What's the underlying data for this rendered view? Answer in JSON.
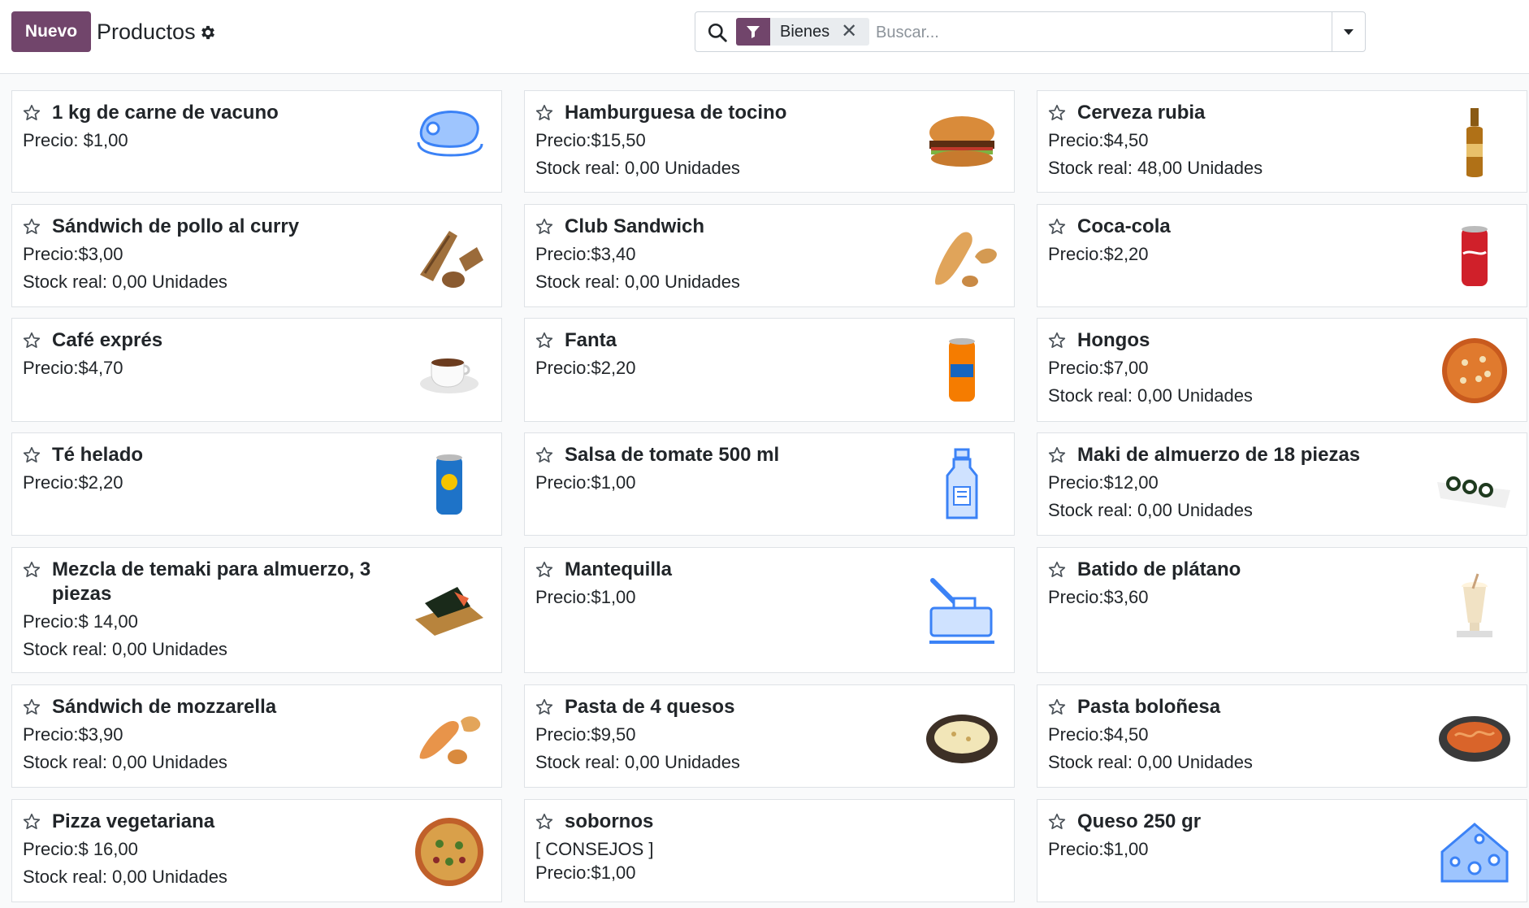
{
  "header": {
    "new_button": "Nuevo",
    "title": "Productos",
    "settings_icon": "gear-icon",
    "search": {
      "icon": "search-icon",
      "facet_icon": "filter-icon",
      "facet_label": "Bienes",
      "facet_remove": "✕",
      "placeholder": "Buscar...",
      "toggle_icon": "caret-down-icon"
    }
  },
  "colors": {
    "brand": "#71456b",
    "text": "#212529",
    "border": "#dee2e6"
  },
  "products": [
    {
      "name": "1 kg de carne de vacuno",
      "lines": [
        "Precio: $1,00"
      ],
      "image": "steak-icon"
    },
    {
      "name": "Hamburguesa de tocino",
      "lines": [
        "Precio:$15,50",
        "Stock real: 0,00 Unidades"
      ],
      "image": "burger-image"
    },
    {
      "name": "Cerveza rubia",
      "lines": [
        "Precio:$4,50",
        "Stock real: 48,00 Unidades"
      ],
      "image": "beer-bottle-image"
    },
    {
      "name": "Sándwich de pollo al curry",
      "lines": [
        "Precio:$3,00",
        "Stock real: 0,00 Unidades"
      ],
      "image": "chicken-sandwich-image"
    },
    {
      "name": "Club Sandwich",
      "lines": [
        "Precio:$3,40",
        "Stock real: 0,00 Unidades"
      ],
      "image": "club-sandwich-image"
    },
    {
      "name": "Coca-cola",
      "lines": [
        "Precio:$2,20"
      ],
      "image": "coke-can-image"
    },
    {
      "name": "Café exprés",
      "lines": [
        "Precio:$4,70"
      ],
      "image": "espresso-cup-image"
    },
    {
      "name": "Fanta",
      "lines": [
        "Precio:$2,20"
      ],
      "image": "fanta-can-image"
    },
    {
      "name": "Hongos",
      "lines": [
        "Precio:$7,00",
        "Stock real: 0,00 Unidades"
      ],
      "image": "mushroom-pizza-image"
    },
    {
      "name": "Té helado",
      "lines": [
        "Precio:$2,20"
      ],
      "image": "iced-tea-can-image"
    },
    {
      "name": "Salsa de tomate 500 ml",
      "lines": [
        "Precio:$1,00"
      ],
      "image": "sauce-bottle-icon"
    },
    {
      "name": "Maki de almuerzo de 18 piezas",
      "lines": [
        "Precio:$12,00",
        "Stock real: 0,00 Unidades"
      ],
      "image": "maki-plate-image"
    },
    {
      "name": "Mezcla de temaki para almuerzo, 3 piezas",
      "lines": [
        "Precio:$ 14,00",
        "Stock real: 0,00 Unidades"
      ],
      "image": "temaki-image"
    },
    {
      "name": "Mantequilla",
      "lines": [
        "Precio:$1,00"
      ],
      "image": "butter-icon"
    },
    {
      "name": "Batido de plátano",
      "lines": [
        "Precio:$3,60"
      ],
      "image": "milkshake-image"
    },
    {
      "name": "Sándwich de mozzarella",
      "lines": [
        "Precio:$3,90",
        "Stock real: 0,00 Unidades"
      ],
      "image": "mozzarella-sandwich-image"
    },
    {
      "name": "Pasta de 4 quesos",
      "lines": [
        "Precio:$9,50",
        "Stock real: 0,00 Unidades"
      ],
      "image": "cheese-pasta-image"
    },
    {
      "name": "Pasta boloñesa",
      "lines": [
        "Precio:$4,50",
        "Stock real: 0,00 Unidades"
      ],
      "image": "bolognese-pasta-image"
    },
    {
      "name": "Pizza vegetariana",
      "lines": [
        "Precio:$ 16,00",
        "Stock real: 0,00 Unidades"
      ],
      "image": "veggie-pizza-image"
    },
    {
      "name": "sobornos",
      "lines": [
        "[ CONSEJOS ]",
        "Precio:$1,00"
      ],
      "image": ""
    },
    {
      "name": "Queso 250 gr",
      "lines": [
        "Precio:$1,00"
      ],
      "image": "cheese-icon"
    }
  ]
}
